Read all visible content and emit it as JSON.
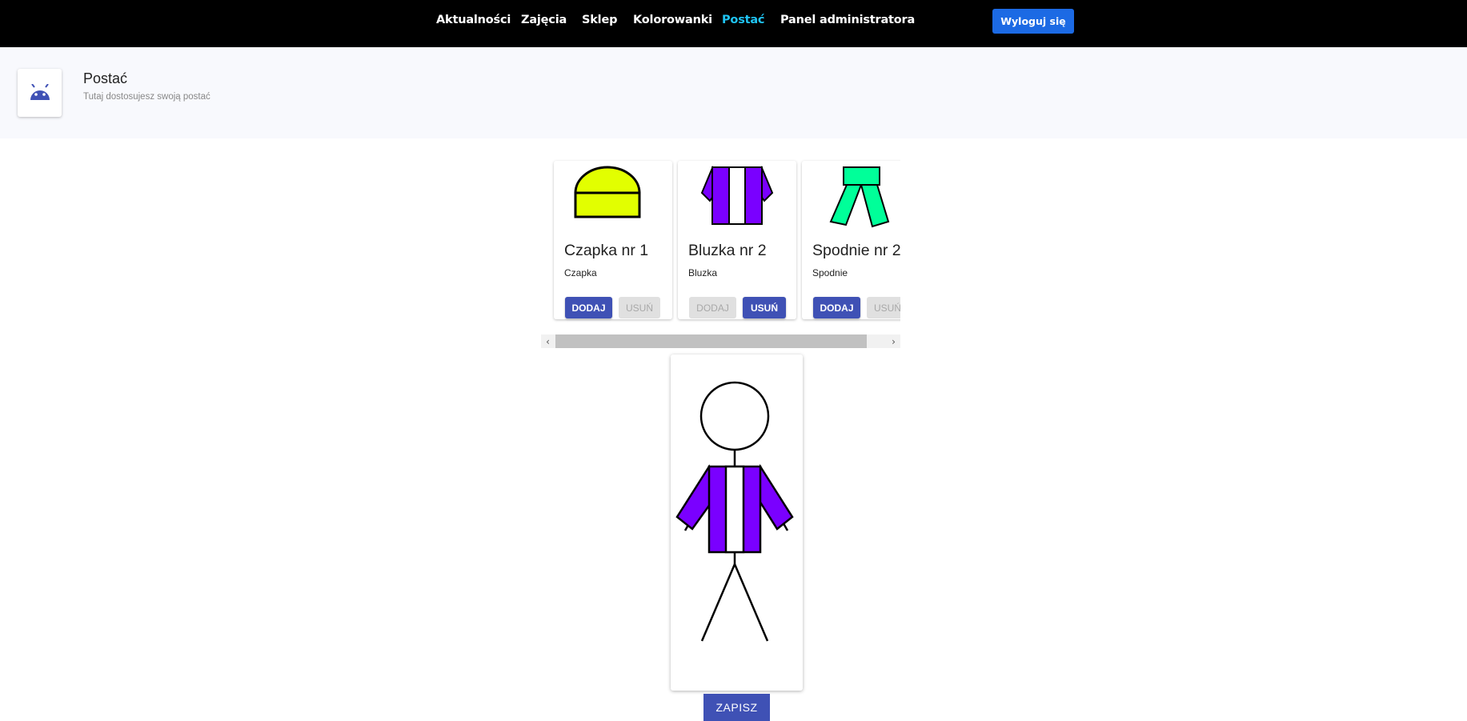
{
  "nav": {
    "items": [
      {
        "label": "Aktualności",
        "active": false
      },
      {
        "label": "Zajęcia",
        "active": false
      },
      {
        "label": "Sklep",
        "active": false
      },
      {
        "label": "Kolorowanki",
        "active": false
      },
      {
        "label": "Postać",
        "active": true
      },
      {
        "label": "Panel administratora",
        "active": false
      }
    ],
    "logout_label": "Wyloguj się"
  },
  "header": {
    "icon": "android-icon",
    "title": "Postać",
    "subtitle": "Tutaj dostosujesz swoją postać"
  },
  "items": [
    {
      "title": "Czapka nr 1",
      "category": "Czapka",
      "add_label": "DODAJ",
      "remove_label": "USUŃ",
      "equipped": false,
      "color": "#e2ff00"
    },
    {
      "title": "Bluzka nr 2",
      "category": "Bluzka",
      "add_label": "DODAJ",
      "remove_label": "USUŃ",
      "equipped": true,
      "color": "#7a00ff"
    },
    {
      "title": "Spodnie nr 2",
      "category": "Spodnie",
      "add_label": "DODAJ",
      "remove_label": "USUŃ",
      "equipped": false,
      "color": "#00ff99"
    }
  ],
  "save_label": "ZAPISZ",
  "colors": {
    "nav_bg": "#000000",
    "nav_active": "#1fc4f4",
    "primary": "#3f51b5",
    "logout": "#1c6ae4"
  }
}
